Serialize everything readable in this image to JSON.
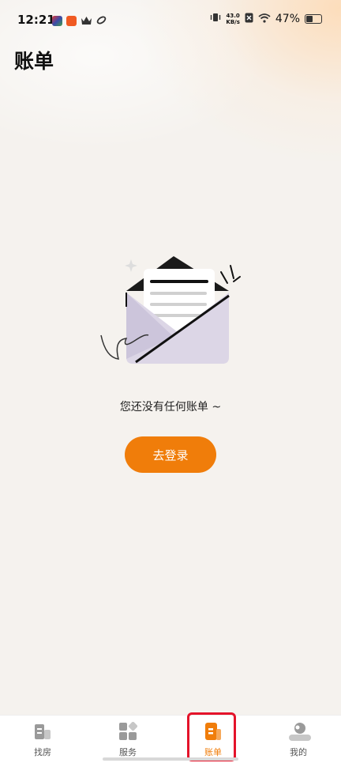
{
  "status_bar": {
    "time": "12:21",
    "net_speed_value": "43.0",
    "net_speed_unit": "KB/s",
    "battery_percent": "47%",
    "left_icons": [
      "app-icon-1",
      "app-icon-2",
      "crown-icon",
      "link-icon"
    ],
    "right_icons": [
      "vibrate-icon",
      "sim-off-icon",
      "wifi-icon",
      "battery-icon"
    ]
  },
  "page": {
    "title": "账单"
  },
  "empty_state": {
    "message": "您还没有任何账单 ~",
    "login_label": "去登录",
    "illustration": "open-envelope-icon"
  },
  "tabbar": {
    "items": [
      {
        "label": "找房",
        "icon": "building-icon",
        "active": false
      },
      {
        "label": "服务",
        "icon": "grid-icon",
        "active": false
      },
      {
        "label": "账单",
        "icon": "bill-icon",
        "active": true
      },
      {
        "label": "我的",
        "icon": "profile-icon",
        "active": false
      }
    ]
  },
  "colors": {
    "accent": "#f07d0a",
    "highlight": "#e4132a",
    "background": "#f5f2ee"
  }
}
